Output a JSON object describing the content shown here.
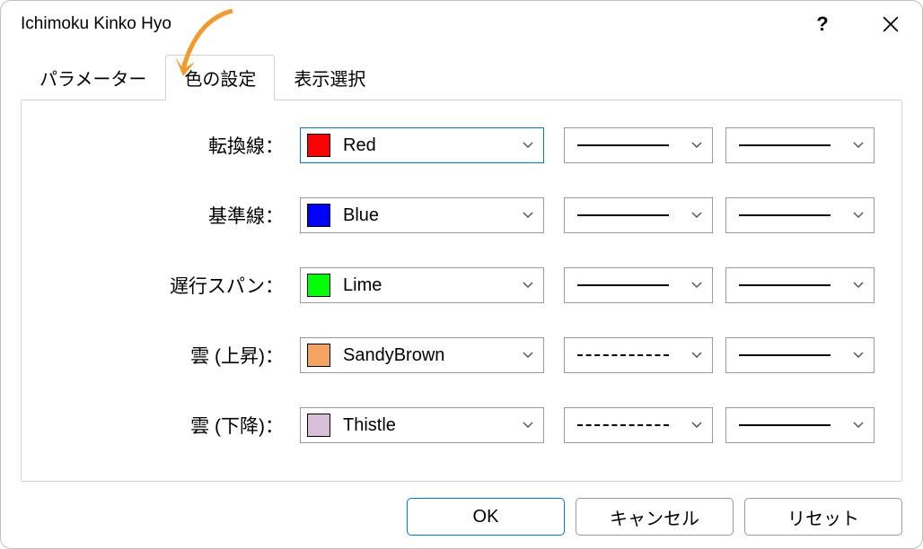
{
  "title": "Ichimoku Kinko Hyo",
  "tabs": {
    "parameters": "パラメーター",
    "colors": "色の設定",
    "display": "表示選択"
  },
  "rows": [
    {
      "label": "転換線：",
      "colorName": "Red",
      "swatch": "#ff0000",
      "lineStyle": "solid",
      "focused": true
    },
    {
      "label": "基準線：",
      "colorName": "Blue",
      "swatch": "#0000ff",
      "lineStyle": "solid",
      "focused": false
    },
    {
      "label": "遅行スパン：",
      "colorName": "Lime",
      "swatch": "#00ff00",
      "lineStyle": "solid",
      "focused": false
    },
    {
      "label": "雲 (上昇)：",
      "colorName": "SandyBrown",
      "swatch": "#f4a460",
      "lineStyle": "dashed",
      "focused": false
    },
    {
      "label": "雲 (下降)：",
      "colorName": "Thistle",
      "swatch": "#d8bfd8",
      "lineStyle": "dashed",
      "focused": false
    }
  ],
  "buttons": {
    "ok": "OK",
    "cancel": "キャンセル",
    "reset": "リセット"
  },
  "help": "?"
}
